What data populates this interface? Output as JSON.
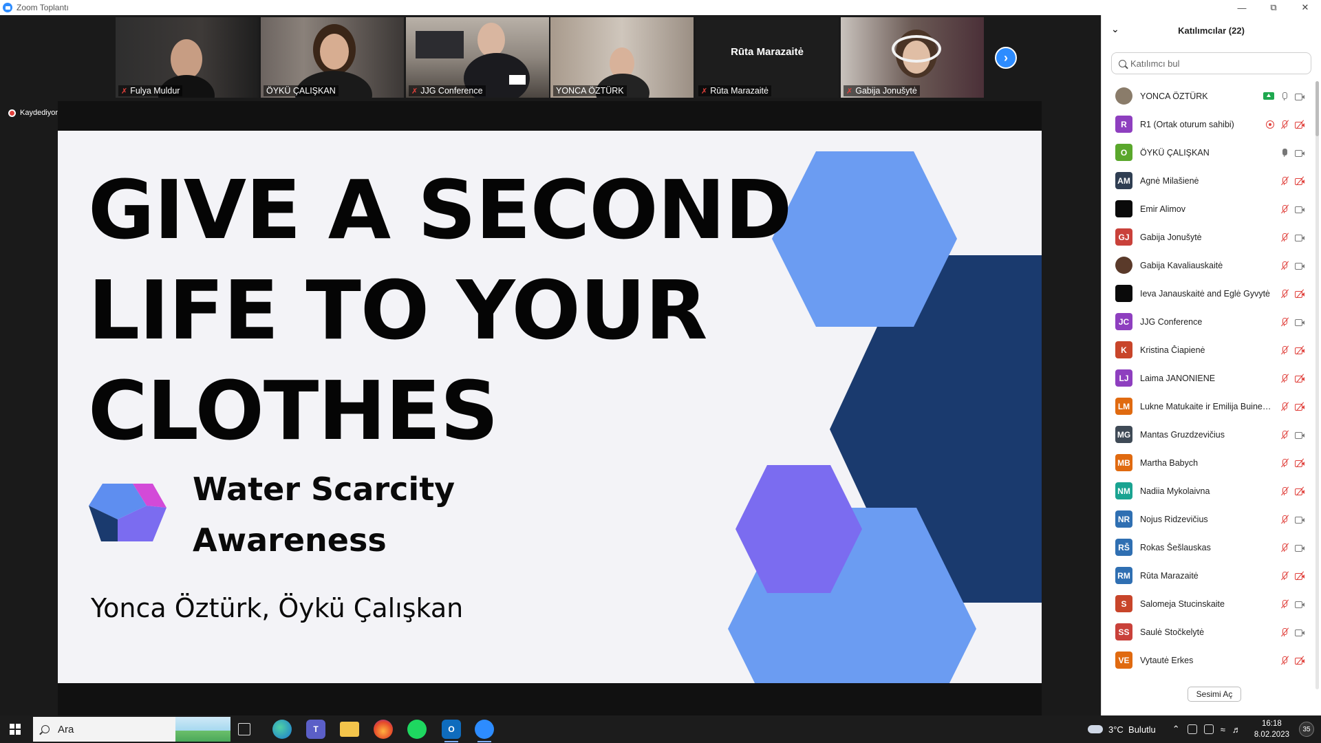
{
  "window": {
    "title": "Zoom Toplantı"
  },
  "strip": {
    "tiles": [
      {
        "name": "Fulya Muldur",
        "muted": true
      },
      {
        "name": "ÖYKÜ ÇALIŞKAN",
        "muted": false
      },
      {
        "name": "JJG Conference",
        "muted": true
      },
      {
        "name": "YONCA ÖZTÜRK",
        "muted": false
      },
      {
        "name": "Rūta Marazaitė",
        "muted": true,
        "center_name": "Rūta Marazaitė"
      },
      {
        "name": "Gabija Jonušytė",
        "muted": true
      }
    ],
    "recording_label": "Kaydediyor"
  },
  "slide": {
    "title_lines": [
      "GIVE A SECOND",
      "LIFE TO YOUR",
      "CLOTHES"
    ],
    "subtitle_lines": [
      "Water Scarcity",
      "Awareness"
    ],
    "authors": "Yonca Öztürk, Öykü Çalışkan",
    "colors": {
      "light_blue": "#6b9cf2",
      "navy": "#1a3a6e",
      "purple": "#7b6cf0",
      "magenta": "#d34ad8"
    }
  },
  "panel": {
    "title": "Katılımcılar (22)",
    "search_placeholder": "Katılımcı bul",
    "participants": [
      {
        "initials": "",
        "name": "YONCA ÖZTÜRK",
        "color": "#8a7c6a",
        "photo": true,
        "sharing": true,
        "mic": "on",
        "cam": "on"
      },
      {
        "initials": "R",
        "name": "R1 (Ortak oturum sahibi)",
        "color": "#8e3fbf",
        "recording": true,
        "mic": "off",
        "cam": "off"
      },
      {
        "initials": "O",
        "name": "ÖYKÜ ÇALIŞKAN",
        "color": "#5aa72c",
        "mic": "live",
        "cam": "on"
      },
      {
        "initials": "AM",
        "name": "Agnė Milašienė",
        "color": "#2f3e52",
        "mic": "off",
        "cam": "off"
      },
      {
        "initials": "",
        "name": "Emir Alimov",
        "color": "#0a0a0a",
        "mic": "off",
        "cam": "on"
      },
      {
        "initials": "GJ",
        "name": "Gabija Jonušytė",
        "color": "#c9413a",
        "mic": "off",
        "cam": "on"
      },
      {
        "initials": "",
        "name": "Gabija Kavaliauskaitė",
        "color": "#5a3a2a",
        "photo": true,
        "mic": "off",
        "cam": "on"
      },
      {
        "initials": "",
        "name": "Ieva Janauskaitė and Eglė Gyvytė",
        "color": "#0a0a0a",
        "mic": "off",
        "cam": "off"
      },
      {
        "initials": "JC",
        "name": "JJG Conference",
        "color": "#8e3fbf",
        "mic": "off",
        "cam": "on"
      },
      {
        "initials": "K",
        "name": "Kristina Čiapienė",
        "color": "#c8452a",
        "mic": "off",
        "cam": "off"
      },
      {
        "initials": "LJ",
        "name": "Laima JANONIENE",
        "color": "#8e3fbf",
        "mic": "off",
        "cam": "off"
      },
      {
        "initials": "LM",
        "name": "Lukne Matukaite ir Emilija Buinevičiūtė",
        "color": "#e06a10",
        "mic": "off",
        "cam": "off"
      },
      {
        "initials": "MG",
        "name": "Mantas Gruzdzevičius",
        "color": "#3f4a56",
        "mic": "off",
        "cam": "on"
      },
      {
        "initials": "MB",
        "name": "Martha Babych",
        "color": "#e06a10",
        "mic": "off",
        "cam": "off"
      },
      {
        "initials": "NM",
        "name": "Nadiia Mykolaivna",
        "color": "#1aa391",
        "mic": "off",
        "cam": "off"
      },
      {
        "initials": "NR",
        "name": "Nojus Ridzevičius",
        "color": "#2f6fb2",
        "mic": "off",
        "cam": "on"
      },
      {
        "initials": "RŠ",
        "name": "Rokas Šešlauskas",
        "color": "#2f6fb2",
        "mic": "off",
        "cam": "on"
      },
      {
        "initials": "RM",
        "name": "Rūta Marazaitė",
        "color": "#2f6fb2",
        "mic": "off",
        "cam": "off"
      },
      {
        "initials": "S",
        "name": "Salomeja Stucinskaite",
        "color": "#c8452a",
        "mic": "off",
        "cam": "on"
      },
      {
        "initials": "SS",
        "name": "Saulė Stočkelytė",
        "color": "#c9413a",
        "mic": "off",
        "cam": "on"
      },
      {
        "initials": "VE",
        "name": "Vytautė Erkes",
        "color": "#e06a10",
        "mic": "off",
        "cam": "off"
      }
    ],
    "unmute_label": "Sesimi Aç"
  },
  "taskbar": {
    "search_label": "Ara",
    "weather": "3°C  Bulutlu",
    "time": "16:18",
    "date": "8.02.2023",
    "notification_count": "35"
  }
}
